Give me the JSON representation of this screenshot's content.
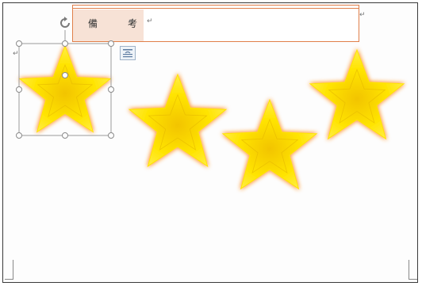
{
  "table": {
    "label": "備　考",
    "label_mark": "↵",
    "value_mark": "↵",
    "end_mark": "↵"
  },
  "document": {
    "paragraph_mark": "↵"
  },
  "selection": {
    "rotate_icon": "rotate-handle-icon",
    "layout_icon": "layout-options-icon"
  },
  "colors": {
    "table_border": "#e07f4a",
    "label_fill": "#f7e2d6",
    "star_fill": "#ffe400",
    "star_glow": "#ff9a3c",
    "selection_handle": "#8a8a8a"
  },
  "stars": {
    "count": 4,
    "selected_index": 0
  }
}
